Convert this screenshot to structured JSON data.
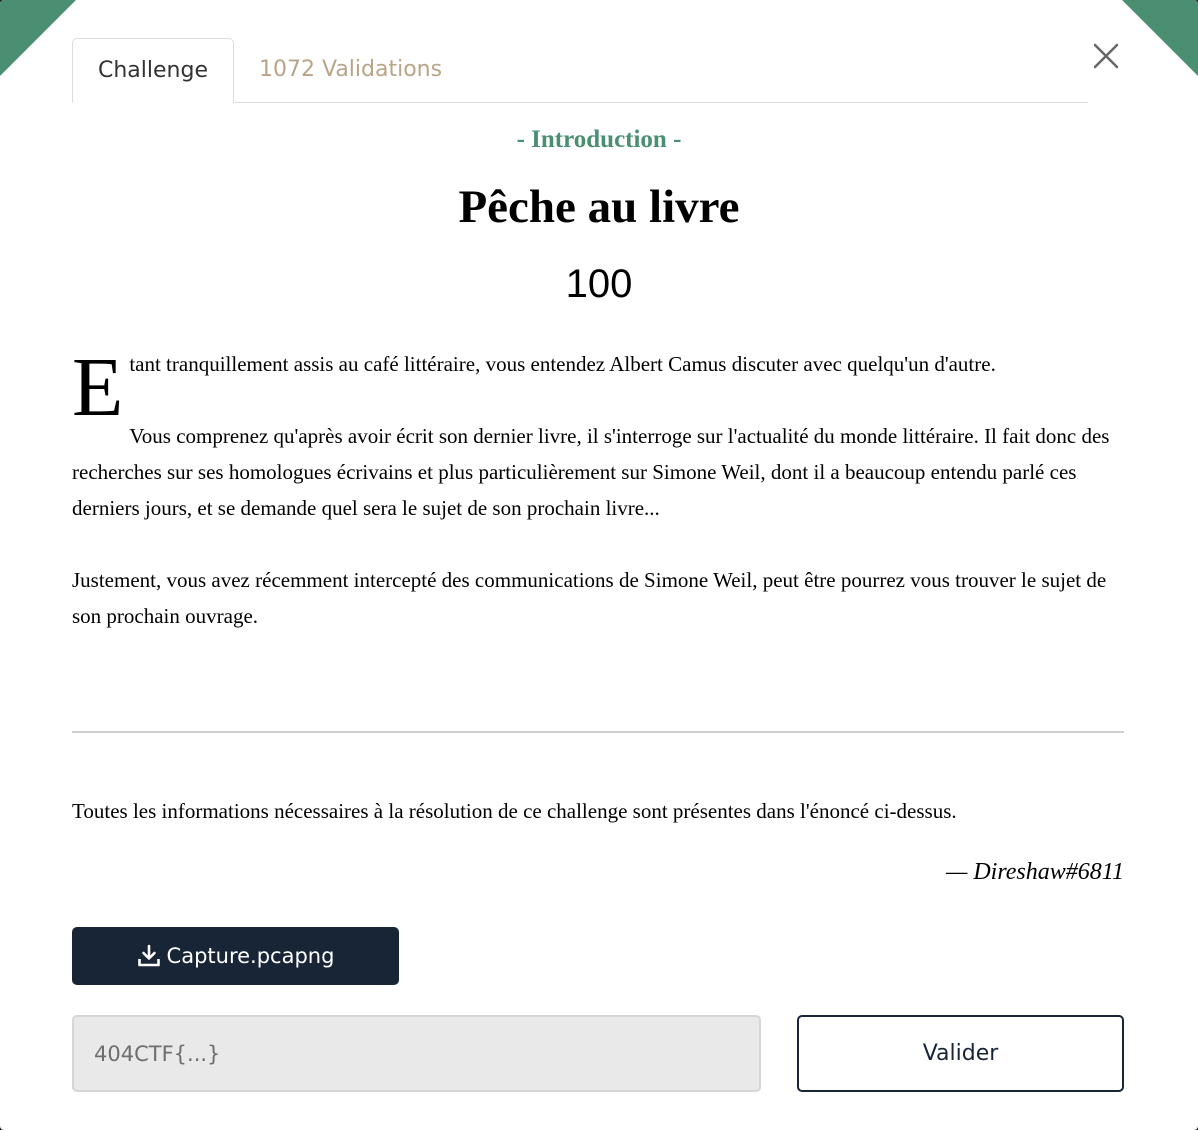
{
  "tabs": [
    {
      "label": "Challenge",
      "active": true
    },
    {
      "label": "1072 Validations",
      "active": false
    }
  ],
  "close_icon": "close-icon",
  "challenge": {
    "category": "- Introduction -",
    "title": "Pêche au livre",
    "points": "100",
    "dropcap": "E",
    "paragraph_1": "tant tranquillement assis au café littéraire, vous entendez Albert Camus discuter avec quelqu'un d'autre.",
    "paragraph_2": "Vous comprenez qu'après avoir écrit son dernier livre, il s'interroge sur l'actualité du monde littéraire. Il fait donc des recherches sur ses homologues écrivains et plus particulièrement sur Simone Weil, dont il a beaucoup entendu parlé ces derniers jours, et se demande quel sera le sujet de son prochain livre...",
    "paragraph_3": "Justement, vous avez récemment intercepté des communications de Simone Weil, peut être pourrez vous trouver le sujet de son prochain ouvrage.",
    "info": "Toutes les informations nécessaires à la résolution de ce challenge sont présentes dans l'énoncé ci-dessus.",
    "author": "— Direshaw#6811"
  },
  "download": {
    "label": "Capture.pcapng",
    "icon": "download-icon"
  },
  "form": {
    "placeholder": "404CTF{...}",
    "value": "",
    "submit_label": "Valider"
  },
  "colors": {
    "accent": "#4b8f73",
    "inactive_tab": "#b8a488",
    "button_dark": "#172536",
    "input_bg": "#e9e9e9"
  }
}
